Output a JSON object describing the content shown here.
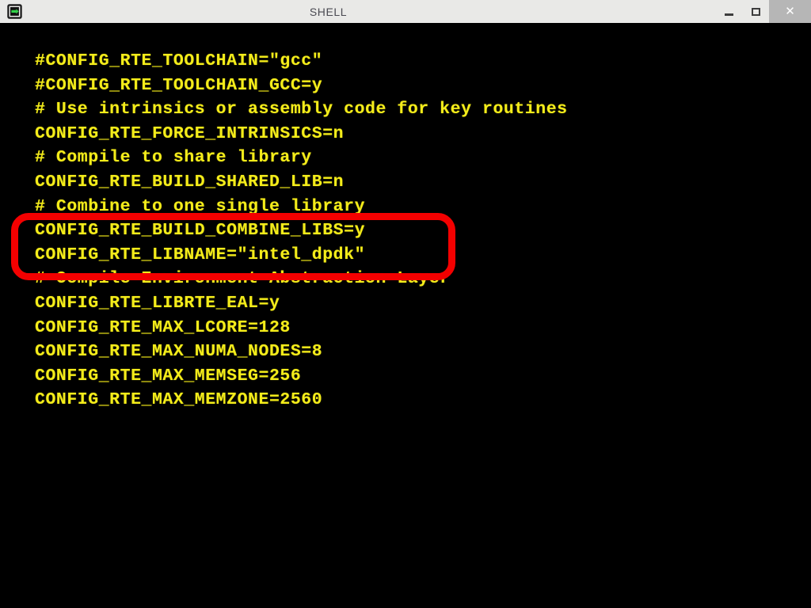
{
  "window": {
    "title": "SHELL",
    "icon": "shell-terminal-icon",
    "controls": {
      "minimize_label": "–",
      "maximize_label": "□",
      "close_label": "✕"
    },
    "titlebar_bg": "#e9e9e7",
    "title_color": "#4a4a52",
    "close_bg": "#b6b6b6"
  },
  "terminal": {
    "background": "#000000",
    "foreground": "#f4ec1a",
    "lines": [
      "#CONFIG_RTE_TOOLCHAIN=\"gcc\"",
      "#CONFIG_RTE_TOOLCHAIN_GCC=y",
      "# Use intrinsics or assembly code for key routines",
      "CONFIG_RTE_FORCE_INTRINSICS=n",
      "# Compile to share library",
      "CONFIG_RTE_BUILD_SHARED_LIB=n",
      "# Combine to one single library",
      "CONFIG_RTE_BUILD_COMBINE_LIBS=y",
      "CONFIG_RTE_LIBNAME=\"intel_dpdk\"",
      "# Compile Environment Abstraction Layer",
      "CONFIG_RTE_LIBRTE_EAL=y",
      "CONFIG_RTE_MAX_LCORE=128",
      "CONFIG_RTE_MAX_NUMA_NODES=8",
      "CONFIG_RTE_MAX_MEMSEG=256",
      "CONFIG_RTE_MAX_MEMZONE=2560"
    ]
  },
  "annotation": {
    "color": "#f40000",
    "shape": "rounded-rectangle",
    "highlighted_lines": [
      "# Combine to one single library",
      "CONFIG_RTE_BUILD_COMBINE_LIBS=y"
    ]
  }
}
